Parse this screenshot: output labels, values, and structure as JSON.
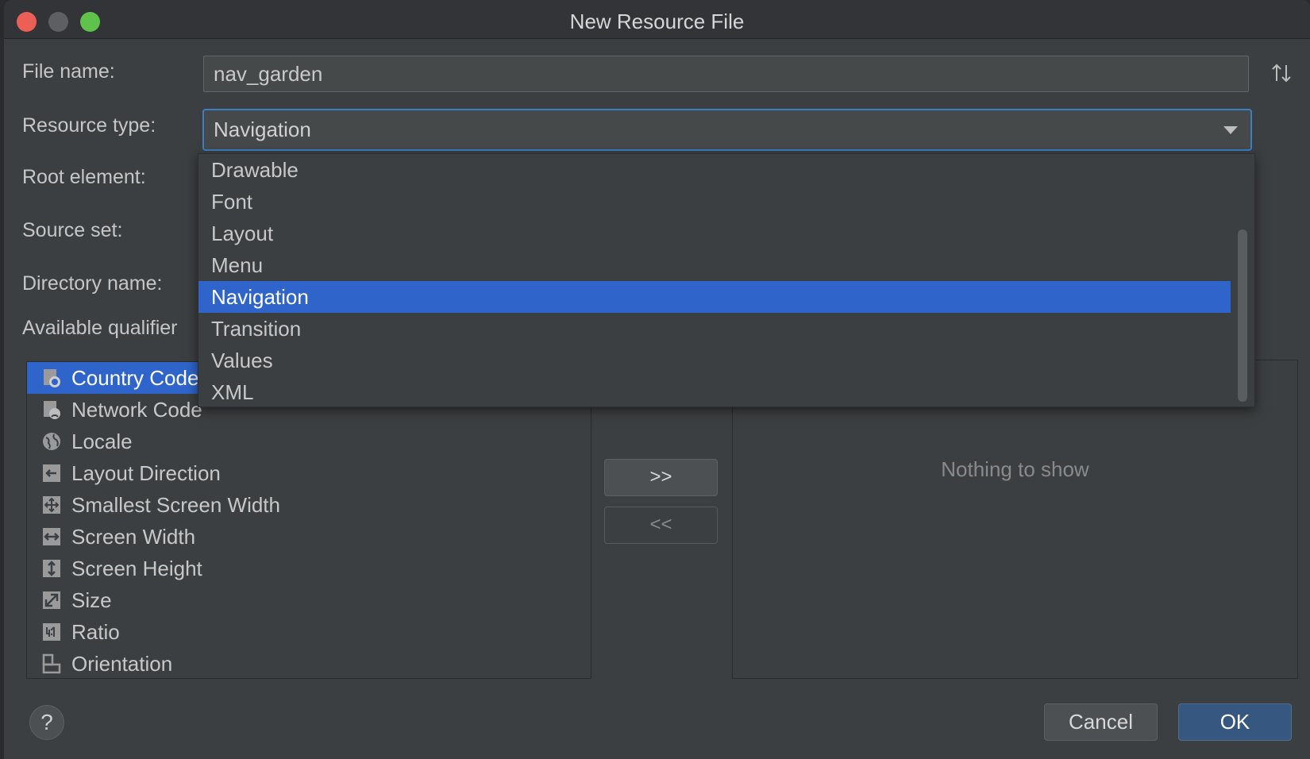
{
  "window": {
    "title": "New Resource File"
  },
  "form": {
    "file_name_label": "File name:",
    "file_name_value": "nav_garden",
    "resource_type_label": "Resource type:",
    "resource_type_value": "Navigation",
    "root_element_label": "Root element:",
    "source_set_label": "Source set:",
    "directory_name_label": "Directory name:",
    "available_qualifiers_label": "Available qualifier"
  },
  "dropdown": {
    "options": [
      "Drawable",
      "Font",
      "Layout",
      "Menu",
      "Navigation",
      "Transition",
      "Values",
      "XML"
    ],
    "selected": "Navigation"
  },
  "qualifiers": {
    "items": [
      {
        "label": "Country Code",
        "icon": "country-code-icon"
      },
      {
        "label": "Network Code",
        "icon": "network-code-icon"
      },
      {
        "label": "Locale",
        "icon": "globe-icon"
      },
      {
        "label": "Layout Direction",
        "icon": "layout-direction-icon"
      },
      {
        "label": "Smallest Screen Width",
        "icon": "smallest-screen-width-icon"
      },
      {
        "label": "Screen Width",
        "icon": "screen-width-icon"
      },
      {
        "label": "Screen Height",
        "icon": "screen-height-icon"
      },
      {
        "label": "Size",
        "icon": "size-icon"
      },
      {
        "label": "Ratio",
        "icon": "ratio-icon"
      },
      {
        "label": "Orientation",
        "icon": "orientation-icon"
      }
    ],
    "selected": "Country Code"
  },
  "buttons": {
    "add": ">>",
    "remove": "<<",
    "help": "?",
    "cancel": "Cancel",
    "ok": "OK"
  },
  "chosen_qualifiers": {
    "empty_text": "Nothing to show"
  },
  "colors": {
    "background": "#3c3f41",
    "selection": "#2f65ca",
    "focus_border": "#3d7ec2",
    "ok_button": "#365880"
  }
}
